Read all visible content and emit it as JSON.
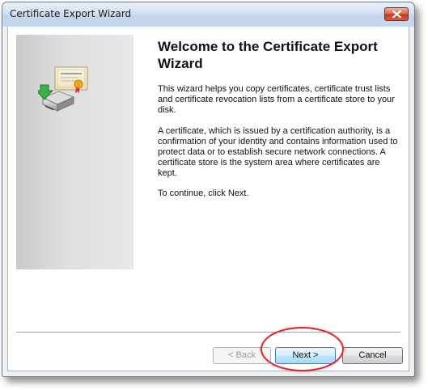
{
  "window": {
    "title": "Certificate Export Wizard"
  },
  "main": {
    "heading": "Welcome to the Certificate Export Wizard",
    "paragraphs": [
      "This wizard helps you copy certificates, certificate trust lists and certificate revocation lists from a certificate store to your disk.",
      "A certificate, which is issued by a certification authority, is a confirmation of your identity and contains information used to protect data or to establish secure network connections. A certificate store is the system area where certificates are kept.",
      "To continue, click Next."
    ]
  },
  "buttons": {
    "back": "< Back",
    "next": "Next >",
    "cancel": "Cancel"
  },
  "colors": {
    "highlight_ring": "#d9272e",
    "default_button_border": "#3c7fb1",
    "close_button": "#c43a1f"
  },
  "icons": {
    "close": "close-icon",
    "wizard_art": "certificate-export-icon"
  }
}
